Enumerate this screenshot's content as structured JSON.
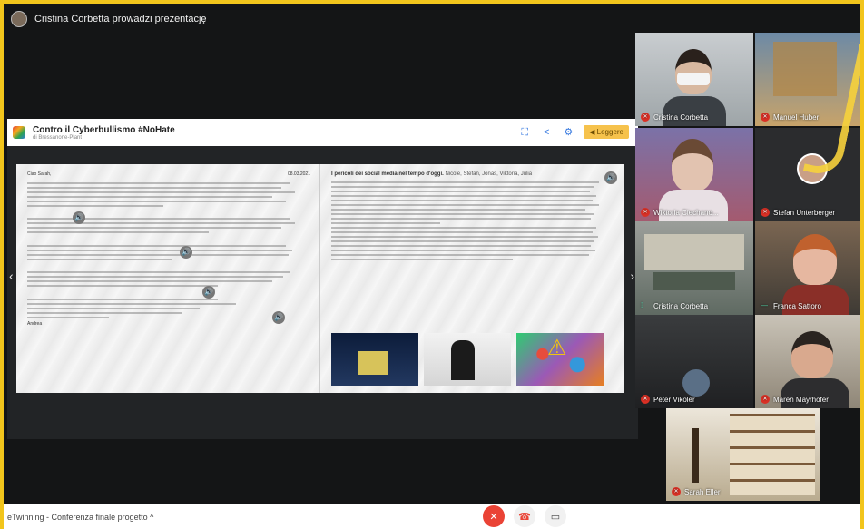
{
  "presenter_banner": "Cristina Corbetta prowadzi prezentację",
  "presentation": {
    "title": "Contro il Cyberbullismo #NoHate",
    "subtitle": "di Bressanone-Plant",
    "read_button": "Leggere",
    "left_page": {
      "date": "08.03.2021",
      "greeting": "Ciao Sarah,",
      "signature": "Andrea"
    },
    "right_page": {
      "heading": "I pericoli dei social media nel tempo d'oggi.",
      "authors": "Nicole, Stefan, Jonas, Viktoria, Julia"
    }
  },
  "participants": [
    {
      "name": "Cristina Corbetta",
      "mic": "off"
    },
    {
      "name": "Manuel Huber",
      "mic": "off"
    },
    {
      "name": "Wiktoria Ciechano...",
      "mic": "off"
    },
    {
      "name": "Stefan Unterberger",
      "mic": "off"
    },
    {
      "name": "Cristina Corbetta",
      "mic": "on"
    },
    {
      "name": "Franca Sattoro",
      "mic": "on"
    },
    {
      "name": "Peter Vikoler",
      "mic": "off"
    },
    {
      "name": "Maren Mayrhofer",
      "mic": "off"
    },
    {
      "name": "Sarah Eller",
      "mic": "off"
    }
  ],
  "meeting_name": "eTwinning - Conferenza finale progetto",
  "icons": {
    "mic_off": "mic-off-icon",
    "hangup": "phone-hangup-icon",
    "camera": "camera-icon"
  },
  "colors": {
    "accent_border": "#f2c51c",
    "mic_off": "#d93025",
    "hangup": "#ea4335"
  }
}
